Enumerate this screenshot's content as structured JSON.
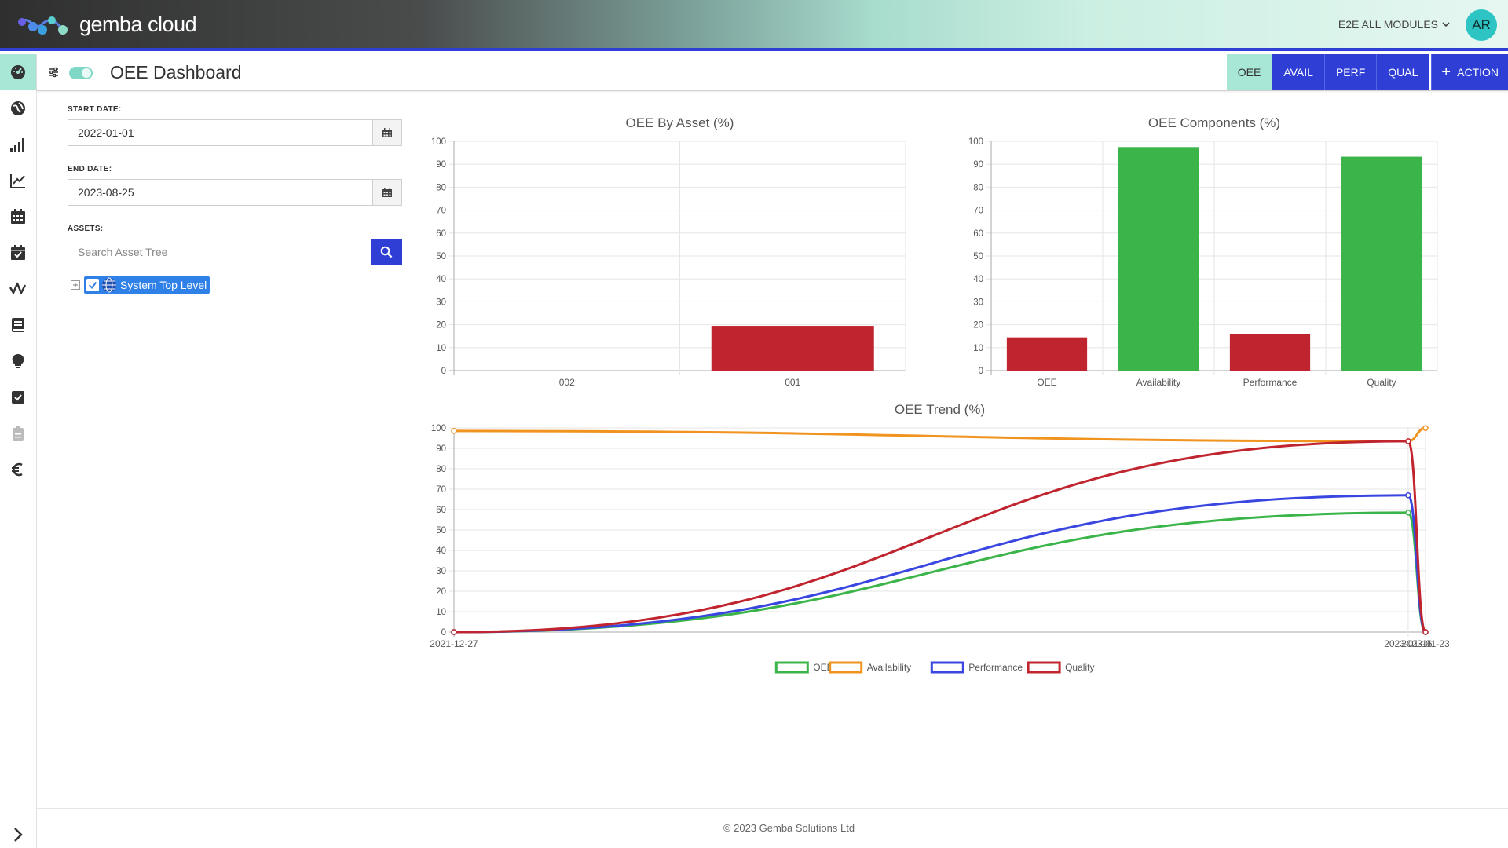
{
  "app": {
    "brand": "gemba cloud",
    "modules_label": "E2E ALL MODULES",
    "user_initials": "AR",
    "accent_color": "#2f3fd6",
    "active_color": "#a8e6d6"
  },
  "rail": {
    "items": [
      {
        "name": "dashboard-icon",
        "active": true
      },
      {
        "name": "globe-icon",
        "active": false
      },
      {
        "name": "signal-bars-icon",
        "active": false
      },
      {
        "name": "line-chart-icon",
        "active": false
      },
      {
        "name": "calendar-icon",
        "active": false
      },
      {
        "name": "calendar-check-icon",
        "active": false
      },
      {
        "name": "trend-wave-icon",
        "active": false
      },
      {
        "name": "book-icon",
        "active": false
      },
      {
        "name": "lightbulb-icon",
        "active": false
      },
      {
        "name": "checkbox-icon",
        "active": false
      },
      {
        "name": "clipboard-icon",
        "active": false
      },
      {
        "name": "euro-icon",
        "active": false
      }
    ],
    "expand_icon": "chevron-right-icon"
  },
  "header": {
    "title": "OEE Dashboard",
    "tabs": [
      {
        "label": "OEE",
        "active": true
      },
      {
        "label": "AVAIL",
        "active": false
      },
      {
        "label": "PERF",
        "active": false
      },
      {
        "label": "QUAL",
        "active": false
      }
    ],
    "action_label": "ACTION"
  },
  "form": {
    "start_label": "START DATE:",
    "start_value": "2022-01-01",
    "end_label": "END DATE:",
    "end_value": "2023-08-25",
    "assets_label": "ASSETS:",
    "search_placeholder": "Search Asset Tree",
    "tree_node": "System Top Level"
  },
  "chart_data": [
    {
      "type": "bar",
      "title": "OEE By Asset (%)",
      "categories": [
        "002",
        "001"
      ],
      "values": [
        0,
        19.5
      ],
      "colors": [
        "#c0242e",
        "#c0242e"
      ],
      "ylim": [
        0,
        100
      ],
      "yticks": [
        0,
        10,
        20,
        30,
        40,
        50,
        60,
        70,
        80,
        90,
        100
      ],
      "grid": true
    },
    {
      "type": "bar",
      "title": "OEE Components (%)",
      "categories": [
        "OEE",
        "Availability",
        "Performance",
        "Quality"
      ],
      "values": [
        14.5,
        97.5,
        15.8,
        93.3
      ],
      "colors": [
        "#c0242e",
        "#3bb54a",
        "#c0242e",
        "#3bb54a"
      ],
      "ylim": [
        0,
        100
      ],
      "yticks": [
        0,
        10,
        20,
        30,
        40,
        50,
        60,
        70,
        80,
        90,
        100
      ],
      "grid": true
    },
    {
      "type": "line",
      "title": "OEE Trend (%)",
      "x": [
        "2021-12-27",
        "2023-01-16",
        "2023-01-23"
      ],
      "series": [
        {
          "name": "OEE",
          "values": [
            0,
            58.5,
            0
          ],
          "color": "#3bb54a"
        },
        {
          "name": "Availability",
          "values": [
            98.5,
            93.5,
            99.9
          ],
          "color": "#f0931f"
        },
        {
          "name": "Performance",
          "values": [
            0,
            67,
            0
          ],
          "color": "#3a46e0"
        },
        {
          "name": "Quality",
          "values": [
            0,
            93.5,
            0
          ],
          "color": "#c0242e"
        }
      ],
      "ylim": [
        0,
        100
      ],
      "yticks": [
        0,
        10,
        20,
        30,
        40,
        50,
        60,
        70,
        80,
        90,
        100
      ],
      "grid": true,
      "legend_position": "bottom"
    }
  ],
  "footer": {
    "copyright": "© 2023 Gemba Solutions Ltd"
  }
}
